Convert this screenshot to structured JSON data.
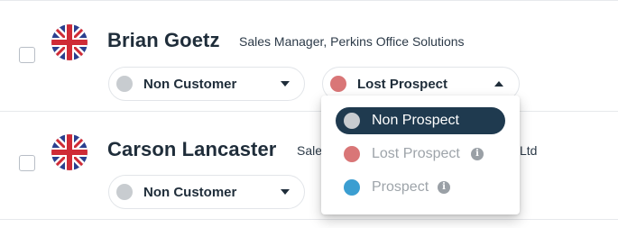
{
  "contacts": [
    {
      "name": "Brian Goetz",
      "title": "Sales Manager, Perkins Office Solutions",
      "flag_icon": "uk-flag-icon",
      "status": {
        "label": "Non Customer",
        "dot_color": "#c8ccd0"
      },
      "prospect": {
        "label": "Lost Prospect",
        "dot_color": "#d97677",
        "open": true
      }
    },
    {
      "name": "Carson Lancaster",
      "title_left": "Sale",
      "title_right": "Ltd",
      "flag_icon": "uk-flag-icon",
      "status": {
        "label": "Non Customer",
        "dot_color": "#c8ccd0"
      }
    }
  ],
  "dropdown": {
    "options": [
      {
        "label": "Non Prospect",
        "dot_color": "#c8ccd0",
        "selected": true,
        "info": false
      },
      {
        "label": "Lost Prospect",
        "dot_color": "#d97677",
        "selected": false,
        "info": true
      },
      {
        "label": "Prospect",
        "dot_color": "#3b9ed1",
        "selected": false,
        "info": true
      }
    ],
    "info_glyph": "i"
  },
  "colors": {
    "selected_bg": "#1f3a4f",
    "text_dark": "#1f2d3a",
    "muted_text": "#9ea4aa"
  }
}
